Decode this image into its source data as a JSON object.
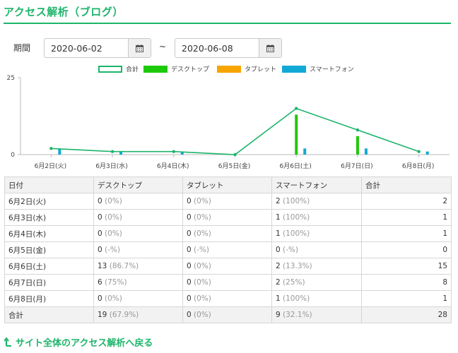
{
  "header": {
    "title": "アクセス解析（ブログ）"
  },
  "period": {
    "label": "期間",
    "start": "2020-06-02",
    "end": "2020-06-08",
    "separator": "~"
  },
  "legend": [
    {
      "label": "合計",
      "color": "#1db56b",
      "style": "outline"
    },
    {
      "label": "デスクトップ",
      "color": "#1ec90a",
      "style": "fill"
    },
    {
      "label": "タブレット",
      "color": "#f7a400",
      "style": "fill"
    },
    {
      "label": "スマートフォン",
      "color": "#12a9d6",
      "style": "fill"
    }
  ],
  "chart_data": {
    "type": "bar",
    "categories": [
      "6月2日(火)",
      "6月3日(水)",
      "6月4日(木)",
      "6月5日(金)",
      "6月6日(土)",
      "6月7日(日)",
      "6月8日(月)"
    ],
    "ylim": [
      0,
      25
    ],
    "yticks": [
      0,
      25
    ],
    "series": [
      {
        "name": "デスクトップ",
        "type": "bar",
        "color": "#1ec90a",
        "values": [
          0,
          0,
          0,
          0,
          13,
          6,
          0
        ]
      },
      {
        "name": "タブレット",
        "type": "bar",
        "color": "#f7a400",
        "values": [
          0,
          0,
          0,
          0,
          0,
          0,
          0
        ]
      },
      {
        "name": "スマートフォン",
        "type": "bar",
        "color": "#12a9d6",
        "values": [
          2,
          1,
          1,
          0,
          2,
          2,
          1
        ]
      },
      {
        "name": "合計",
        "type": "line",
        "color": "#1db56b",
        "values": [
          2,
          1,
          1,
          0,
          15,
          8,
          1
        ]
      }
    ],
    "grid": false,
    "legend_position": "top"
  },
  "table": {
    "headers": [
      "日付",
      "デスクトップ",
      "タブレット",
      "スマートフォン",
      "合計"
    ],
    "rows": [
      {
        "date": "6月2日(火)",
        "desktop": "0",
        "desktop_pct": "(0%)",
        "tablet": "0",
        "tablet_pct": "(0%)",
        "smartphone": "2",
        "smartphone_pct": "(100%)",
        "total": "2"
      },
      {
        "date": "6月3日(水)",
        "desktop": "0",
        "desktop_pct": "(0%)",
        "tablet": "0",
        "tablet_pct": "(0%)",
        "smartphone": "1",
        "smartphone_pct": "(100%)",
        "total": "1"
      },
      {
        "date": "6月4日(木)",
        "desktop": "0",
        "desktop_pct": "(0%)",
        "tablet": "0",
        "tablet_pct": "(0%)",
        "smartphone": "1",
        "smartphone_pct": "(100%)",
        "total": "1"
      },
      {
        "date": "6月5日(金)",
        "desktop": "0",
        "desktop_pct": "(-%)",
        "tablet": "0",
        "tablet_pct": "(-%)",
        "smartphone": "0",
        "smartphone_pct": "(-%)",
        "total": "0"
      },
      {
        "date": "6月6日(土)",
        "desktop": "13",
        "desktop_pct": "(86.7%)",
        "tablet": "0",
        "tablet_pct": "(0%)",
        "smartphone": "2",
        "smartphone_pct": "(13.3%)",
        "total": "15"
      },
      {
        "date": "6月7日(日)",
        "desktop": "6",
        "desktop_pct": "(75%)",
        "tablet": "0",
        "tablet_pct": "(0%)",
        "smartphone": "2",
        "smartphone_pct": "(25%)",
        "total": "8"
      },
      {
        "date": "6月8日(月)",
        "desktop": "0",
        "desktop_pct": "(0%)",
        "tablet": "0",
        "tablet_pct": "(0%)",
        "smartphone": "1",
        "smartphone_pct": "(100%)",
        "total": "1"
      }
    ],
    "total_row": {
      "date": "合計",
      "desktop": "19",
      "desktop_pct": "(67.9%)",
      "tablet": "0",
      "tablet_pct": "(0%)",
      "smartphone": "9",
      "smartphone_pct": "(32.1%)",
      "total": "28"
    }
  },
  "footer": {
    "back_link": "サイト全体のアクセス解析へ戻る",
    "back_icon": "return-arrow-icon"
  },
  "icons": {
    "calendar": "calendar-icon"
  }
}
